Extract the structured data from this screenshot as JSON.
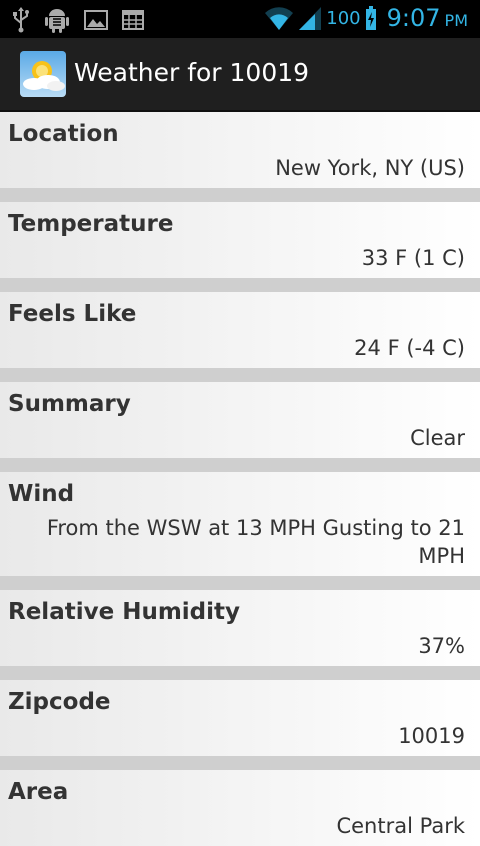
{
  "status_bar": {
    "battery_level": "100",
    "time": "9:07",
    "ampm": "PM",
    "accent_color": "#33b5e5",
    "icons": [
      "usb-icon",
      "android-debug-icon",
      "gallery-icon",
      "calendar-icon",
      "wifi-icon",
      "signal-icon",
      "battery-charging-icon"
    ]
  },
  "action_bar": {
    "title": "Weather for 10019",
    "app_icon": "weather-app-icon"
  },
  "weather": {
    "items": [
      {
        "label": "Location",
        "value": "New York, NY (US)"
      },
      {
        "label": "Temperature",
        "value": "33 F (1 C)"
      },
      {
        "label": "Feels Like",
        "value": "24 F (-4 C)"
      },
      {
        "label": "Summary",
        "value": "Clear"
      },
      {
        "label": "Wind",
        "value": "From the WSW at 13 MPH Gusting to 21 MPH"
      },
      {
        "label": "Relative Humidity",
        "value": "37%"
      },
      {
        "label": "Zipcode",
        "value": "10019"
      },
      {
        "label": "Area",
        "value": "Central Park"
      }
    ]
  }
}
